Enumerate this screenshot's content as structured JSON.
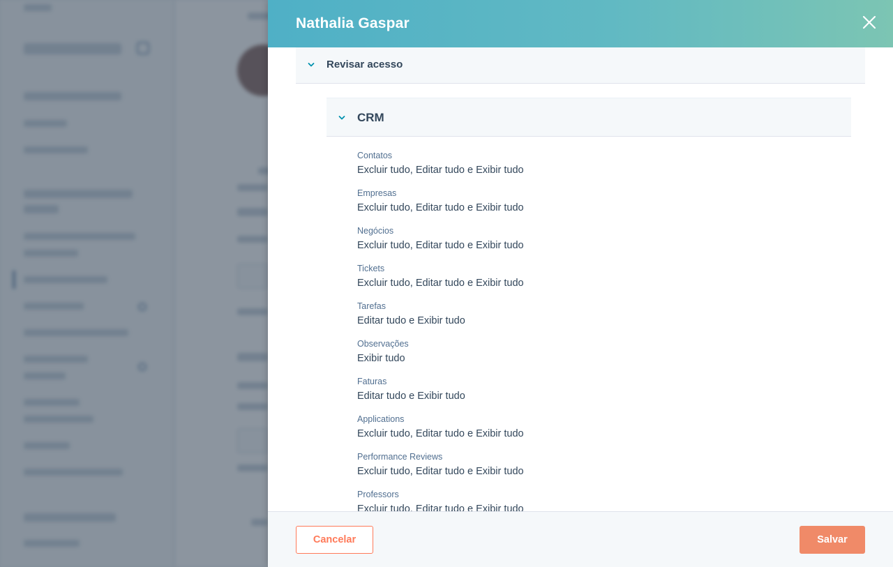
{
  "modal": {
    "title": "Nathalia Gaspar",
    "section_label": "Revisar acesso",
    "subsection_label": "CRM",
    "permissions": [
      {
        "name": "Contatos",
        "value": "Excluir tudo, Editar tudo e Exibir tudo"
      },
      {
        "name": "Empresas",
        "value": "Excluir tudo, Editar tudo e Exibir tudo"
      },
      {
        "name": "Negócios",
        "value": "Excluir tudo, Editar tudo e Exibir tudo"
      },
      {
        "name": "Tickets",
        "value": "Excluir tudo, Editar tudo e Exibir tudo"
      },
      {
        "name": "Tarefas",
        "value": "Editar tudo e Exibir tudo"
      },
      {
        "name": "Observações",
        "value": "Exibir tudo"
      },
      {
        "name": "Faturas",
        "value": "Editar tudo e Exibir tudo"
      },
      {
        "name": "Applications",
        "value": "Excluir tudo, Editar tudo e Exibir tudo"
      },
      {
        "name": "Performance Reviews",
        "value": "Excluir tudo, Editar tudo e Exibir tudo"
      },
      {
        "name": "Professors",
        "value": "Excluir tudo, Editar tudo e Exibir tudo"
      }
    ],
    "cancel_label": "Cancelar",
    "save_label": "Salvar"
  },
  "icons": {
    "close": "close-icon",
    "section_chevron": "chevron-down-icon",
    "subsection_chevron": "chevron-down-icon"
  },
  "colors": {
    "header_gradient_start": "#4fb0c6",
    "header_gradient_end": "#7cc5b3",
    "accent_orange": "#ff7a59",
    "save_button": "#f08a68",
    "text_primary": "#33475b",
    "text_secondary": "#516f90"
  }
}
